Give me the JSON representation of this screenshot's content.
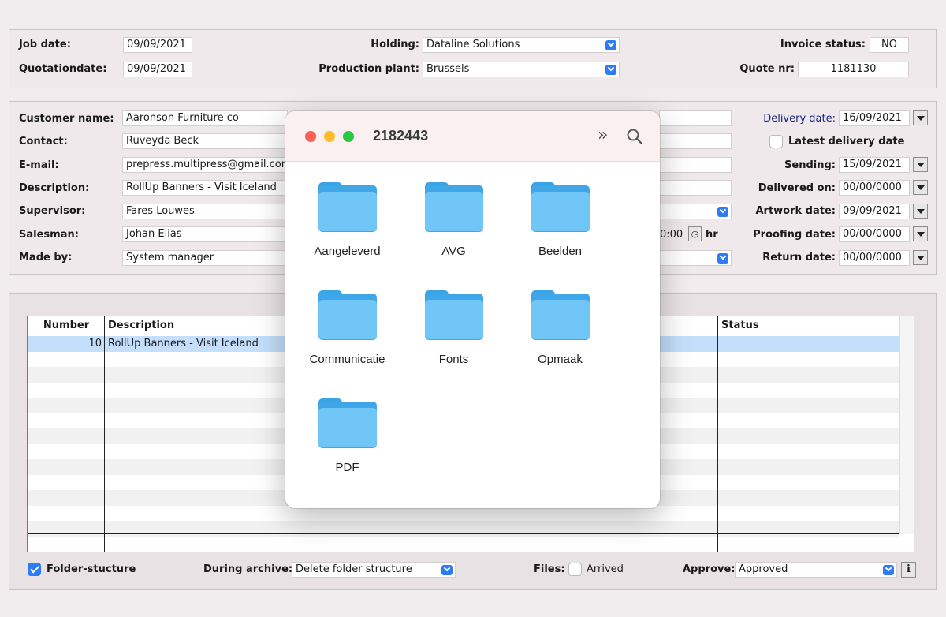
{
  "header": {
    "job_date_label": "Job date:",
    "job_date": "09/09/2021",
    "quotation_date_label": "Quotationdate:",
    "quotation_date": "09/09/2021",
    "holding_label": "Holding:",
    "holding": "Dataline Solutions",
    "production_plant_label": "Production plant:",
    "production_plant": "Brussels",
    "invoice_status_label": "Invoice status:",
    "invoice_status": "NO",
    "quote_nr_label": "Quote nr:",
    "quote_nr": "1181130"
  },
  "customer": {
    "customer_name_label": "Customer name:",
    "customer_name": "Aaronson Furniture co",
    "contact_label": "Contact:",
    "contact": "Ruveyda Beck",
    "email_label": "E-mail:",
    "email": "prepress.multipress@gmail.com",
    "description_label": "Description:",
    "description": "RollUp Banners - Visit Iceland",
    "supervisor_label": "Supervisor:",
    "supervisor": "Fares Louwes",
    "salesman_label": "Salesman:",
    "salesman": "Johan Elias",
    "made_by_label": "Made by:",
    "made_by": "System manager",
    "time_fragment": "0:00",
    "hr_label": "hr"
  },
  "dates": {
    "delivery_date_label": "Delivery date:",
    "delivery_date": "16/09/2021",
    "latest_delivery_label": "Latest delivery date",
    "sending_label": "Sending:",
    "sending": "15/09/2021",
    "delivered_on_label": "Delivered on:",
    "delivered_on": "00/00/0000",
    "artwork_date_label": "Artwork date:",
    "artwork_date": "09/09/2021",
    "proofing_date_label": "Proofing date:",
    "proofing_date": "00/00/0000",
    "return_date_label": "Return date:",
    "return_date": "00/00/0000"
  },
  "table": {
    "columns": [
      "Number",
      "Description",
      "Status"
    ],
    "rows": [
      {
        "number": "10",
        "description": "RollUp Banners - Visit Iceland",
        "status": ""
      }
    ]
  },
  "footer": {
    "folder_structure_label": "Folder-stucture",
    "during_archive_label": "During archive:",
    "during_archive": "Delete folder structure",
    "files_label": "Files:",
    "arrived_label": "Arrived",
    "approve_label": "Approve:",
    "approve": "Approved",
    "info_label": "i"
  },
  "finder": {
    "title": "2182443",
    "folders": [
      "Aangeleverd",
      "AVG",
      "Beelden",
      "Communicatie",
      "Fonts",
      "Opmaak",
      "PDF"
    ]
  },
  "colors": {
    "accent": "#2d7cf6",
    "folder_light": "#71c6f8",
    "folder_dark": "#3fa6e8",
    "selected_row": "#c3dffb",
    "close": "#ff5f57",
    "minimize": "#febc2e",
    "zoom": "#28c840"
  }
}
